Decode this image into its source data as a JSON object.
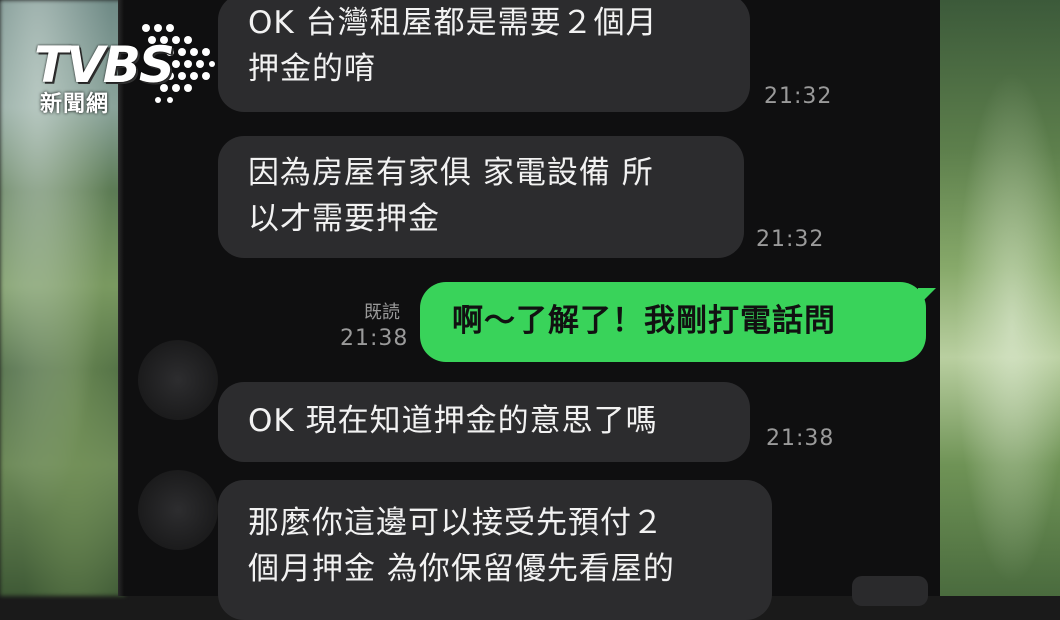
{
  "watermark": {
    "brand": "TVBS",
    "subtitle": "新聞網"
  },
  "chat": {
    "messages": [
      {
        "direction": "in",
        "text": "OK 台灣租屋都是需要２個月\n押金的唷",
        "time": "21:32"
      },
      {
        "direction": "in",
        "text": "因為房屋有家俱 家電設備 所\n以才需要押金",
        "time": "21:32"
      },
      {
        "direction": "out",
        "text": "啊～了解了！我剛打電話問",
        "time": "21:38",
        "status": "既読"
      },
      {
        "direction": "in",
        "text": "OK 現在知道押金的意思了嗎",
        "time": "21:38"
      },
      {
        "direction": "in",
        "text": "那麼你這邊可以接受先預付２\n個月押金 為你保留優先看屋的",
        "time": ""
      }
    ]
  },
  "colors": {
    "incoming_bubble": "#2c2c2e",
    "outgoing_bubble": "#39d35a",
    "chat_background": "#0f0f10"
  }
}
